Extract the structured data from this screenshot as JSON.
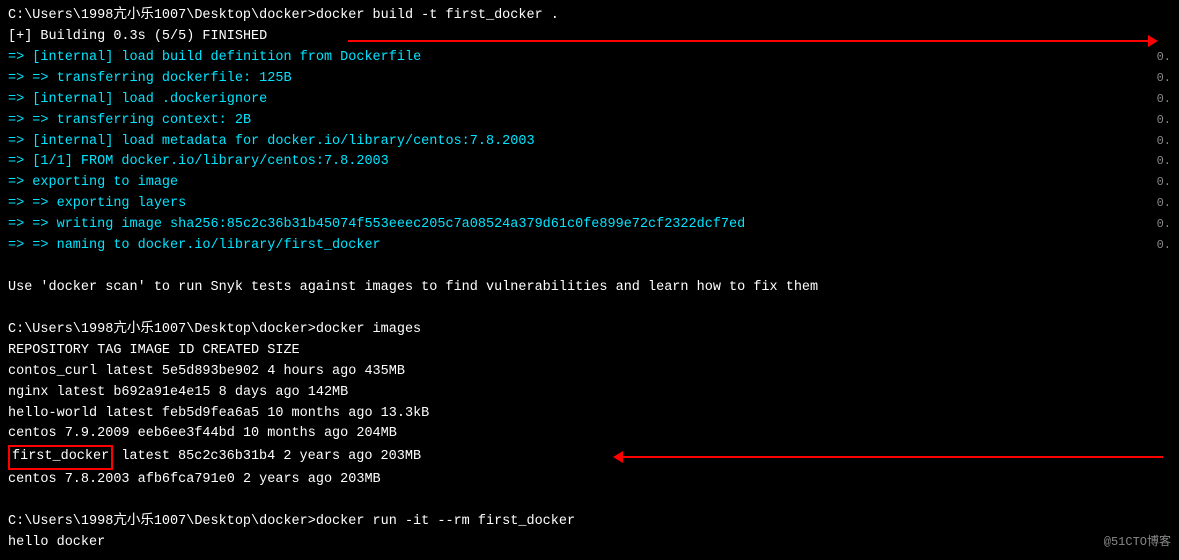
{
  "terminal": {
    "lines": [
      {
        "text": "C:\\Users\\1998亢小乐1007\\Desktop\\docker>docker build -t first_docker .",
        "color": "white",
        "num": ""
      },
      {
        "text": "[+] Building 0.3s (5/5) FINISHED",
        "color": "white",
        "num": ""
      },
      {
        "text": " => [internal] load build definition from Dockerfile",
        "color": "cyan",
        "num": "0."
      },
      {
        "text": " => => transferring dockerfile: 125B",
        "color": "cyan",
        "num": "0."
      },
      {
        "text": " => [internal] load .dockerignore",
        "color": "cyan",
        "num": "0."
      },
      {
        "text": " => => transferring context: 2B",
        "color": "cyan",
        "num": "0."
      },
      {
        "text": " => [internal] load metadata for docker.io/library/centos:7.8.2003",
        "color": "cyan",
        "num": "0."
      },
      {
        "text": " => [1/1] FROM docker.io/library/centos:7.8.2003",
        "color": "cyan",
        "num": "0."
      },
      {
        "text": " => exporting to image",
        "color": "cyan",
        "num": "0."
      },
      {
        "text": " => => exporting layers",
        "color": "cyan",
        "num": "0."
      },
      {
        "text": " => => writing image sha256:85c2c36b31b45074f553eeec205c7a08524a379d61c0fe899e72cf2322dcf7ed",
        "color": "cyan",
        "num": "0."
      },
      {
        "text": " => => naming to docker.io/library/first_docker",
        "color": "cyan",
        "num": "0."
      },
      {
        "text": "",
        "color": "white",
        "num": ""
      },
      {
        "text": "Use 'docker scan' to run Snyk tests against images to find vulnerabilities and learn how to fix them",
        "color": "white",
        "num": ""
      },
      {
        "text": "",
        "color": "white",
        "num": ""
      },
      {
        "text": "C:\\Users\\1998亢小乐1007\\Desktop\\docker>docker images",
        "color": "white",
        "num": ""
      },
      {
        "text": "REPOSITORY      TAG         IMAGE ID         CREATED          SIZE",
        "color": "white",
        "num": ""
      },
      {
        "text": "contos_curl     latest      5e5d893be902     4 hours ago      435MB",
        "color": "white",
        "num": ""
      },
      {
        "text": "nginx           latest      b692a91e4e15     8 days ago       142MB",
        "color": "white",
        "num": ""
      },
      {
        "text": "hello-world     latest      feb5d9fea6a5     10 months ago    13.3kB",
        "color": "white",
        "num": ""
      },
      {
        "text": "centos          7.9.2009    eeb6ee3f44bd     10 months ago    204MB",
        "color": "white",
        "num": ""
      },
      {
        "text": "first_docker    latest      85c2c36b31b4     2 years ago      203MB",
        "color": "white",
        "num": "",
        "highlight": true
      },
      {
        "text": "centos          7.8.2003    afb6fca791e0     2 years ago      203MB",
        "color": "white",
        "num": ""
      },
      {
        "text": "",
        "color": "white",
        "num": ""
      },
      {
        "text": "C:\\Users\\1998亢小乐1007\\Desktop\\docker>docker run -it --rm first_docker",
        "color": "white",
        "num": ""
      },
      {
        "text": "hello docker",
        "color": "white",
        "num": ""
      }
    ],
    "watermark": "@51CTO博客"
  }
}
